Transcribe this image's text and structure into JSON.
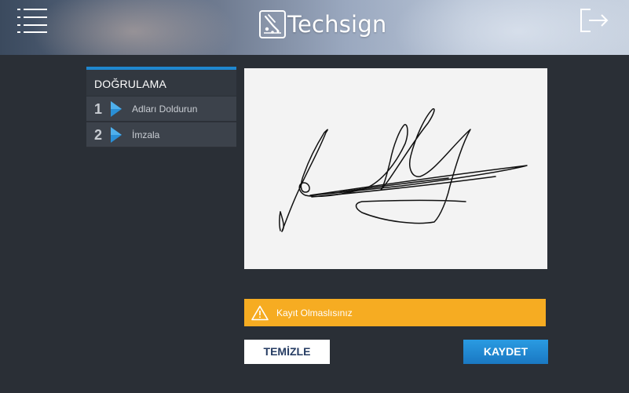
{
  "header": {
    "logo_text": "Techsign",
    "menu_icon": "hamburger-menu-icon",
    "logout_icon": "logout-icon"
  },
  "steps": {
    "title": "DOĞRULAMA",
    "items": [
      {
        "number": "1",
        "label": "Adları Doldurun"
      },
      {
        "number": "2",
        "label": "İmzala"
      }
    ]
  },
  "signature_pad": {
    "content": "handwritten-signature"
  },
  "warning": {
    "icon": "warning-triangle-icon",
    "text": "Kayıt Olmaslısınız"
  },
  "buttons": {
    "clear_label": "TEMİZLE",
    "save_label": "KAYDET"
  },
  "colors": {
    "background": "#2a2f36",
    "accent_blue": "#1f87cf",
    "warning_orange": "#f6ac22",
    "save_button": "#2a9be2",
    "clear_text": "#263c63"
  }
}
